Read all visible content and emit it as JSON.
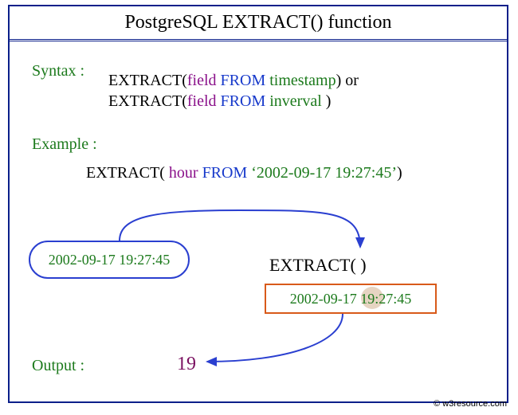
{
  "title": "PostgreSQL  EXTRACT() function",
  "labels": {
    "syntax": "Syntax :",
    "example": "Example :",
    "output": "Output :"
  },
  "syntax": {
    "fn": "EXTRACT(",
    "field": "field",
    "from": "FROM",
    "timestamp": "timestamp",
    "interval": "inverval",
    "close_or": ")    or",
    "close": " )"
  },
  "example": {
    "fn": "EXTRACT(",
    "hour": " hour",
    "from": "FROM",
    "literal": "‘2002-09-17 19:27:45’",
    "close": ")"
  },
  "capsule_value": "2002-09-17 19:27:45",
  "extract_call": "EXTRACT(   )",
  "result_value": "2002-09-17 19:27:45",
  "output_value": "19",
  "credit": "© w3resource.com"
}
